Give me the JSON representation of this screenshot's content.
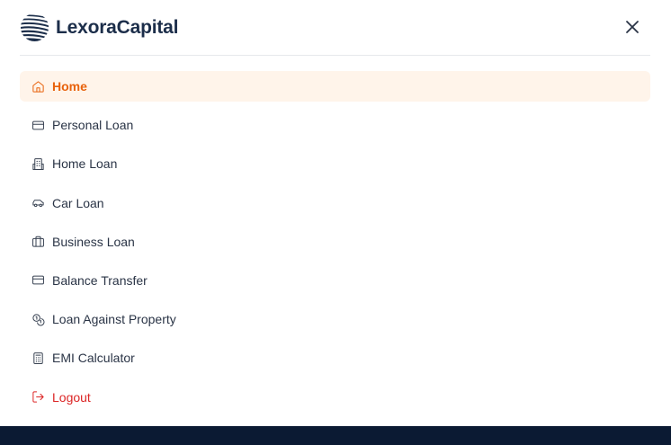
{
  "header": {
    "brand": "LexoraCapital",
    "logo_icon": "striped-globe-logo",
    "close_icon": "close-icon"
  },
  "menu": {
    "active_color": "#e8620c",
    "active_background": "#fff4ea",
    "logout_color": "#dc2626",
    "items": [
      {
        "label": "Home",
        "icon": "home-icon",
        "active": true
      },
      {
        "label": "Personal Loan",
        "icon": "credit-card-icon"
      },
      {
        "label": "Home Loan",
        "icon": "building-icon"
      },
      {
        "label": "Car Loan",
        "icon": "car-icon"
      },
      {
        "label": "Business Loan",
        "icon": "briefcase-icon"
      },
      {
        "label": "Balance Transfer",
        "icon": "credit-card-icon"
      },
      {
        "label": "Loan Against Property",
        "icon": "coins-icon"
      },
      {
        "label": "EMI Calculator",
        "icon": "calculator-icon"
      },
      {
        "label": "Logout",
        "icon": "logout-icon"
      }
    ]
  },
  "footer": {
    "background": "#0b1a33"
  }
}
